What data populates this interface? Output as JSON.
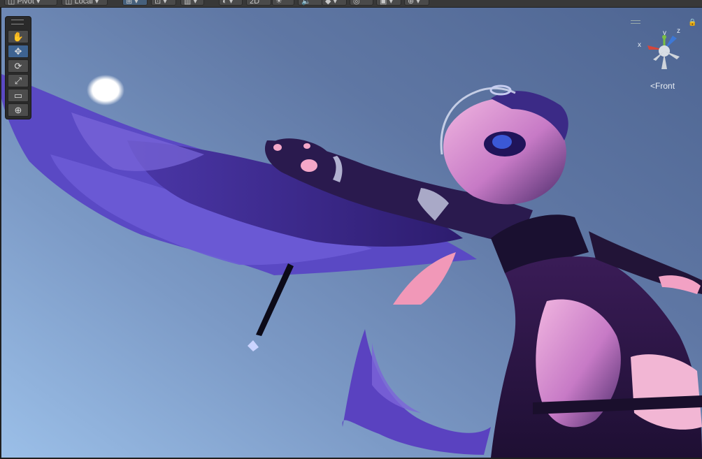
{
  "toolbar": {
    "pivot_label": "Pivot",
    "space_label": "Local",
    "mode_2d_label": "2D",
    "items": [
      {
        "id": "pivot-dropdown",
        "label": "Pivot"
      },
      {
        "id": "space-dropdown",
        "label": "Local"
      }
    ]
  },
  "tools": [
    {
      "name": "hand-tool",
      "glyph": "✋",
      "active": false
    },
    {
      "name": "move-tool",
      "glyph": "✥",
      "active": true
    },
    {
      "name": "rotate-tool",
      "glyph": "⟳",
      "active": false
    },
    {
      "name": "scale-tool",
      "glyph": "⤢",
      "active": false
    },
    {
      "name": "rect-tool",
      "glyph": "▭",
      "active": false
    },
    {
      "name": "transform-tool",
      "glyph": "⊕",
      "active": false
    }
  ],
  "gizmo": {
    "view_label": "Front",
    "axis_y": "y",
    "axis_x": "x",
    "axis_z": "z"
  },
  "colors": {
    "accent": "#3e6391",
    "sky_light": "#9bbfe8",
    "sky_dark": "#4e6592"
  }
}
